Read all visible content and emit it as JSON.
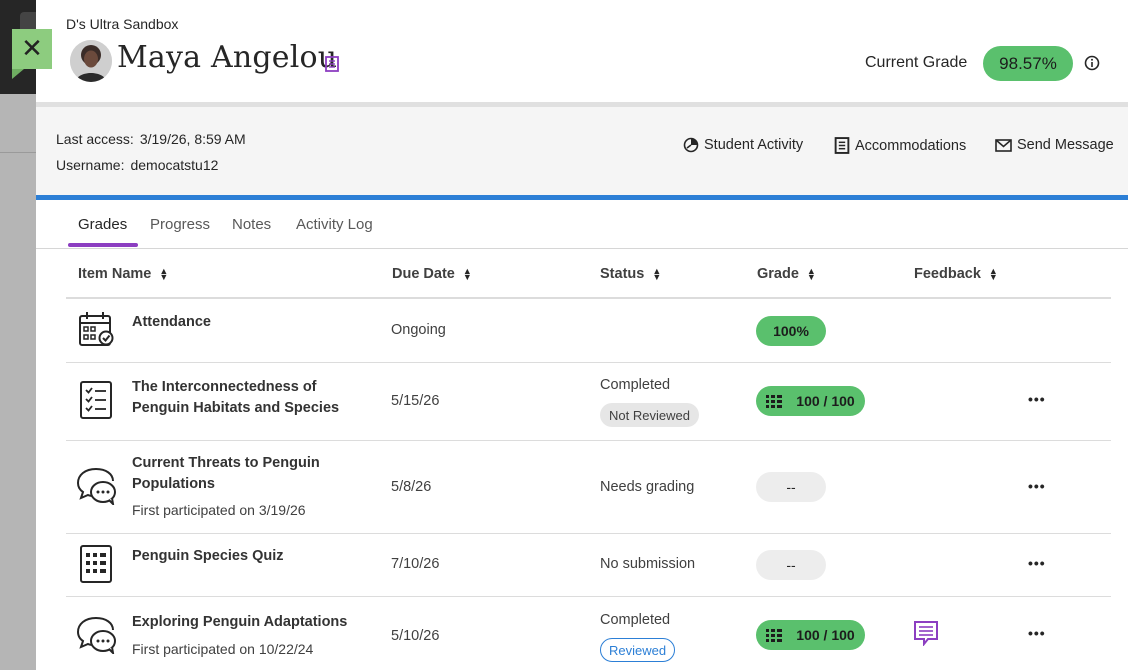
{
  "course": {
    "name": "D's Ultra Sandbox"
  },
  "student": {
    "name": "Maya Angelou"
  },
  "current_grade": {
    "label": "Current Grade",
    "value": "98.57%"
  },
  "meta": {
    "last_access_label": "Last access:",
    "last_access_value": "3/19/26, 8:59 AM",
    "username_label": "Username:",
    "username_value": "democatstu12"
  },
  "actions": {
    "student_activity": "Student Activity",
    "accommodations": "Accommodations",
    "send_message": "Send Message"
  },
  "tabs": [
    {
      "label": "Grades",
      "active": true
    },
    {
      "label": "Progress",
      "active": false
    },
    {
      "label": "Notes",
      "active": false
    },
    {
      "label": "Activity Log",
      "active": false
    }
  ],
  "columns": {
    "item_name": "Item Name",
    "due_date": "Due Date",
    "status": "Status",
    "grade": "Grade",
    "feedback": "Feedback"
  },
  "rows": [
    {
      "icon": "calendar-check-icon",
      "title": "Attendance",
      "sub": "",
      "due": "Ongoing",
      "status": "",
      "badge": "",
      "grade": "100%",
      "grade_style": "green",
      "feedback": false,
      "more": false
    },
    {
      "icon": "checklist-icon",
      "title": "The Interconnectedness of Penguin Habitats and Species",
      "sub": "",
      "due": "5/15/26",
      "status": "Completed",
      "badge": "Not Reviewed",
      "grade": "100 / 100",
      "grade_style": "green",
      "feedback": false,
      "more": true
    },
    {
      "icon": "discussion-icon",
      "title": "Current Threats to Penguin Populations",
      "sub": "First participated on 3/19/26",
      "due": "5/8/26",
      "status": "Needs grading",
      "badge": "",
      "grade": "--",
      "grade_style": "grey",
      "feedback": false,
      "more": true
    },
    {
      "icon": "quiz-icon",
      "title": "Penguin Species Quiz",
      "sub": "",
      "due": "7/10/26",
      "status": "No submission",
      "badge": "",
      "grade": "--",
      "grade_style": "grey",
      "feedback": false,
      "more": true
    },
    {
      "icon": "discussion-icon",
      "title": "Exploring Penguin Adaptations",
      "sub": "First participated on 10/22/24",
      "due": "5/10/26",
      "status": "Completed",
      "badge": "Reviewed",
      "grade": "100 / 100",
      "grade_style": "green",
      "feedback": true,
      "more": true
    }
  ],
  "more_label": "•••",
  "colors": {
    "grade_green": "#5ac06d",
    "accent_purple": "#8c3ec1",
    "accent_blue": "#2c7fd6",
    "close_green": "#8dcc7f"
  }
}
